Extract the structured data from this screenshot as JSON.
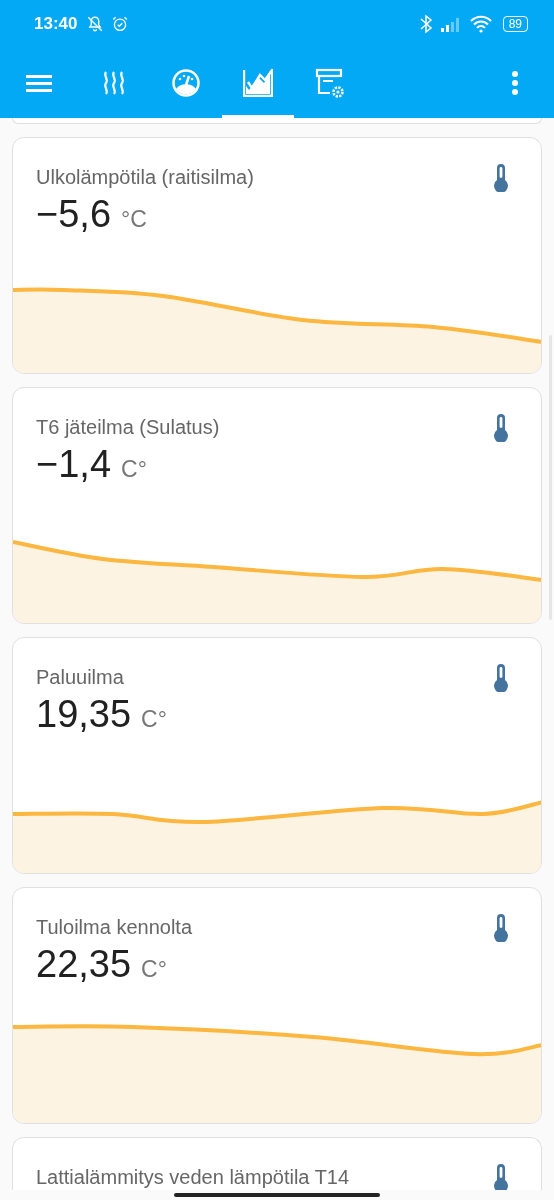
{
  "status_bar": {
    "time": "13:40",
    "battery": "89"
  },
  "toolbar": {
    "tabs": [
      {
        "selected": false
      },
      {
        "selected": false
      },
      {
        "selected": true
      },
      {
        "selected": false
      }
    ]
  },
  "cards": [
    {
      "title": "Ulkolämpötila (raitisilma)",
      "value": "−5,6",
      "unit": "°C"
    },
    {
      "title": "T6 jäteilma (Sulatus)",
      "value": "−1,4",
      "unit": "C°"
    },
    {
      "title": "Paluuilma",
      "value": "19,35",
      "unit": "C°"
    },
    {
      "title": "Tuloilma kennolta",
      "value": "22,35",
      "unit": "C°"
    },
    {
      "title": "Lattialämmitys veden lämpötila T14"
    }
  ]
}
